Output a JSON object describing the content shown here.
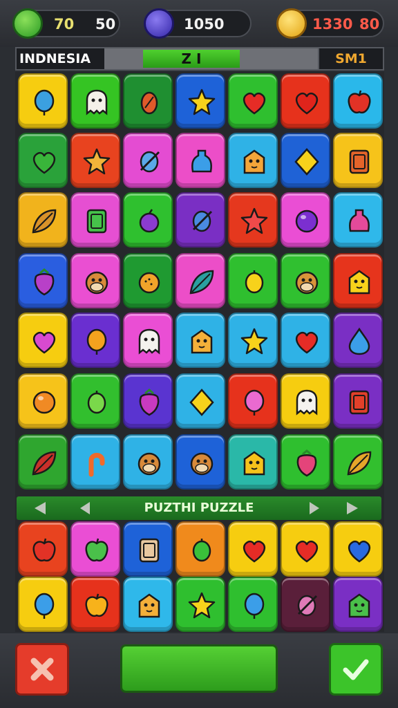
{
  "hud": {
    "leaves": {
      "value": "70",
      "value2": "50"
    },
    "gems": {
      "value": "1050"
    },
    "stars": {
      "value": "1330",
      "value2": "80"
    }
  },
  "info": {
    "level_label": "INDNESIA",
    "progress_text": "Z I",
    "moves_label": "SM1"
  },
  "banner": {
    "title": "PUZTHI PUZZLE"
  },
  "colors": {
    "accent_green": "#2a9c18",
    "hud_dark": "#1d1f23",
    "cancel_red": "#e53c2b",
    "confirm_green": "#3cc42a"
  },
  "rows": [
    [
      {
        "c": "#f6cd10",
        "i": "balloon",
        "ic": "#3ba0e0"
      },
      {
        "c": "#35c423",
        "i": "ghost",
        "ic": "#f4f0e8"
      },
      {
        "c": "#1f8f31",
        "i": "fruit",
        "ic": "#e05a2a"
      },
      {
        "c": "#1e62d8",
        "i": "star",
        "ic": "#f7d21b"
      },
      {
        "c": "#2fbf2f",
        "i": "heart",
        "ic": "#e62c26"
      },
      {
        "c": "#e6321c",
        "i": "heart",
        "ic": "#e0241c"
      },
      {
        "c": "#2ab8ea",
        "i": "apple",
        "ic": "#e23226"
      }
    ],
    [
      {
        "c": "#2aa23a",
        "i": "heart",
        "ic": "#39b53a"
      },
      {
        "c": "#e8431f",
        "i": "star",
        "ic": "#f0b43a"
      },
      {
        "c": "#e44cd2",
        "i": "candy",
        "ic": "#5aa8e8"
      },
      {
        "c": "#ec4ec8",
        "i": "bottle",
        "ic": "#3b9ee8"
      },
      {
        "c": "#2fb2e6",
        "i": "house",
        "ic": "#f3a53a"
      },
      {
        "c": "#1f62d6",
        "i": "diamond",
        "ic": "#f7d21b"
      },
      {
        "c": "#f6c31a",
        "i": "jar",
        "ic": "#e4642a"
      }
    ],
    [
      {
        "c": "#f1b31c",
        "i": "leaf",
        "ic": "#d8922a"
      },
      {
        "c": "#e64fd2",
        "i": "jar",
        "ic": "#46c24a"
      },
      {
        "c": "#2fc02f",
        "i": "plum",
        "ic": "#8b3bd0"
      },
      {
        "c": "#7a2fc4",
        "i": "candy",
        "ic": "#4a8ae0"
      },
      {
        "c": "#e5381e",
        "i": "star",
        "ic": "#f04a4a"
      },
      {
        "c": "#ea4ed4",
        "i": "ball",
        "ic": "#7b2fd0"
      },
      {
        "c": "#2fb8ea",
        "i": "bottle",
        "ic": "#e44a9a"
      }
    ],
    [
      {
        "c": "#2a5ee0",
        "i": "berry",
        "ic": "#b840c8"
      },
      {
        "c": "#ea4fd2",
        "i": "monkey",
        "ic": "#d88a3a"
      },
      {
        "c": "#1f9a31",
        "i": "orange",
        "ic": "#f0a42a"
      },
      {
        "c": "#ec4ec8",
        "i": "leaf",
        "ic": "#2aa0a0"
      },
      {
        "c": "#2fbf2f",
        "i": "lemon",
        "ic": "#f7d21b"
      },
      {
        "c": "#30c030",
        "i": "monkey",
        "ic": "#d8943a"
      },
      {
        "c": "#e6341c",
        "i": "house",
        "ic": "#f7d21b"
      }
    ],
    [
      {
        "c": "#f6cd10",
        "i": "heart",
        "ic": "#d84ad0"
      },
      {
        "c": "#6a2fd0",
        "i": "balloon",
        "ic": "#f4a21e"
      },
      {
        "c": "#ea4ed4",
        "i": "ghost",
        "ic": "#f4f2ee"
      },
      {
        "c": "#2fb2e6",
        "i": "house",
        "ic": "#f3b03a"
      },
      {
        "c": "#2fb2e6",
        "i": "star",
        "ic": "#f7d21b"
      },
      {
        "c": "#2fb2e6",
        "i": "heart",
        "ic": "#e62c26"
      },
      {
        "c": "#7a2fc4",
        "i": "drop",
        "ic": "#3b9ee8"
      }
    ],
    [
      {
        "c": "#f6c31a",
        "i": "ball",
        "ic": "#f08a24"
      },
      {
        "c": "#32bf2e",
        "i": "lemon",
        "ic": "#7ad84a"
      },
      {
        "c": "#5a34d0",
        "i": "berry",
        "ic": "#c83ac0"
      },
      {
        "c": "#2fb2e6",
        "i": "diamond",
        "ic": "#f7d21b"
      },
      {
        "c": "#e6321c",
        "i": "balloon",
        "ic": "#ea6ad0"
      },
      {
        "c": "#f6cd10",
        "i": "ghost",
        "ic": "#f4f2ee"
      },
      {
        "c": "#7a2fc4",
        "i": "jar",
        "ic": "#e2402a"
      }
    ],
    [
      {
        "c": "#2fa62f",
        "i": "leaf",
        "ic": "#c8302a"
      },
      {
        "c": "#2fb2e6",
        "i": "cane",
        "ic": "#f06a2a"
      },
      {
        "c": "#2fb2e6",
        "i": "monkey",
        "ic": "#d88a3a"
      },
      {
        "c": "#1e62d8",
        "i": "monkey",
        "ic": "#d88a3a"
      },
      {
        "c": "#2ab8a8",
        "i": "house",
        "ic": "#f7c21b"
      },
      {
        "c": "#2fbf2f",
        "i": "berry",
        "ic": "#e4447a"
      },
      {
        "c": "#32bf2e",
        "i": "leaf",
        "ic": "#e6a52a"
      }
    ],
    [
      {
        "c": "#e8431f",
        "i": "apple",
        "ic": "#e23226"
      },
      {
        "c": "#ea4ed4",
        "i": "apple",
        "ic": "#4ac04a"
      },
      {
        "c": "#1e62d8",
        "i": "jar",
        "ic": "#e8c8a0"
      },
      {
        "c": "#f08a1c",
        "i": "lemon",
        "ic": "#3ac03a"
      },
      {
        "c": "#f6cd10",
        "i": "heart",
        "ic": "#e62c26"
      },
      {
        "c": "#f6cd10",
        "i": "heart",
        "ic": "#e62c26"
      },
      {
        "c": "#f6cd10",
        "i": "heart",
        "ic": "#2a6ae0"
      }
    ],
    [
      {
        "c": "#f6cd10",
        "i": "balloon",
        "ic": "#3b9ee8"
      },
      {
        "c": "#e6321c",
        "i": "apple",
        "ic": "#f7b21b"
      },
      {
        "c": "#2fb8ea",
        "i": "house",
        "ic": "#f3b03a"
      },
      {
        "c": "#2fbf2f",
        "i": "star",
        "ic": "#f7d21b"
      },
      {
        "c": "#2fbf2f",
        "i": "balloon",
        "ic": "#3b9ee8"
      },
      {
        "c": "#5a1f3a",
        "i": "candy",
        "ic": "#e07ab8"
      },
      {
        "c": "#7a2fc4",
        "i": "house",
        "ic": "#4ac04a"
      }
    ]
  ]
}
